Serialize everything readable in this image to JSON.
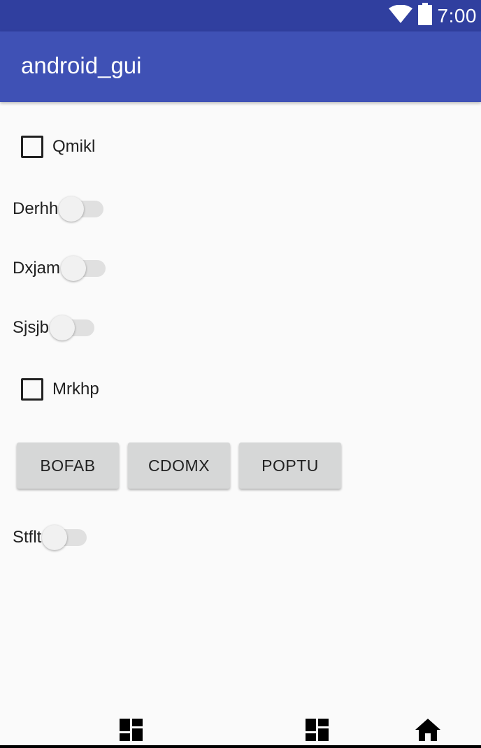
{
  "status_bar": {
    "time": "7:00",
    "icons": [
      "wifi-icon",
      "battery-icon"
    ]
  },
  "app_bar": {
    "title": "android_gui"
  },
  "controls": {
    "checkbox_1": "Qmikl",
    "switch_1": "Derhh",
    "switch_2": "Dxjam",
    "switch_3": "Sjsjb",
    "checkbox_2": "Mrkhp",
    "buttons": [
      "BOFAB",
      "CDOMX",
      "POPTU"
    ],
    "switch_4": "Stflt"
  },
  "nav_bar": {
    "icons": [
      "dashboard-icon",
      "dashboard-icon",
      "home-icon"
    ]
  },
  "colors": {
    "status_bar": "#303F9F",
    "app_bar": "#3F51B5",
    "background": "#FAFAFA",
    "button": "#D6D7D7"
  }
}
